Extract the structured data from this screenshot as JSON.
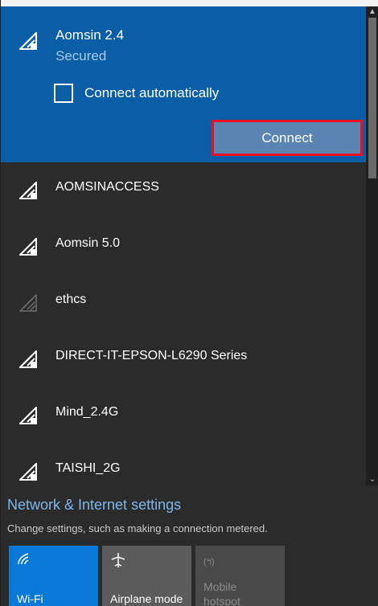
{
  "selected_network": {
    "name": "Aomsin 2.4",
    "status": "Secured",
    "connect_automatically_label": "Connect automatically",
    "connect_button_label": "Connect"
  },
  "networks": [
    {
      "name": "AOMSINACCESS",
      "icon": "wifi-secured-icon"
    },
    {
      "name": "Aomsin 5.0",
      "icon": "wifi-secured-icon"
    },
    {
      "name": "ethcs",
      "icon": "wifi-weak-icon"
    },
    {
      "name": "DIRECT-IT-EPSON-L6290 Series",
      "icon": "wifi-secured-icon"
    },
    {
      "name": "Mind_2.4G",
      "icon": "wifi-secured-icon"
    },
    {
      "name": "TAISHI_2G",
      "icon": "wifi-secured-icon"
    }
  ],
  "footer": {
    "settings_link": "Network & Internet settings",
    "settings_hint": "Change settings, such as making a connection metered."
  },
  "quick_actions": {
    "wifi_label": "Wi-Fi",
    "airplane_label": "Airplane mode",
    "hotspot_line1": "Mobile",
    "hotspot_line2": "hotspot",
    "hotspot_icon_text": "(ฯ)"
  },
  "colors": {
    "accent": "#0a5ea6",
    "tile_active": "#0a78d7",
    "link": "#7fb7ea",
    "highlight_border": "#e81123"
  }
}
